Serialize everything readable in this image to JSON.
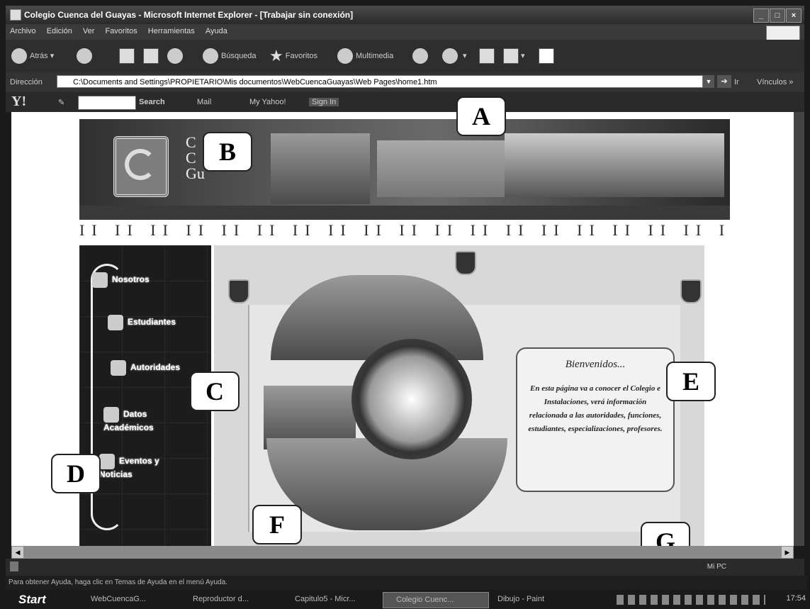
{
  "window": {
    "title": "Colegio Cuenca del Guayas - Microsoft Internet Explorer - [Trabajar sin conexión]",
    "controls": [
      "_",
      "□",
      "×"
    ]
  },
  "menu": [
    "Archivo",
    "Edición",
    "Ver",
    "Favoritos",
    "Herramientas",
    "Ayuda"
  ],
  "toolbar": {
    "back": "Atrás",
    "search": "Búsqueda",
    "favorites": "Favoritos",
    "multimedia": "Multimedia"
  },
  "address": {
    "label": "Dirección",
    "value": "C:\\Documents and Settings\\PROPIETARIO\\Mis documentos\\WebCuencaGuayas\\Web Pages\\home1.htm",
    "go": "Ir",
    "links": "Vínculos »"
  },
  "yahoo": {
    "logo": "Y!",
    "search": "Search",
    "mail": "Mail",
    "my_yahoo": "My Yahoo!",
    "sign_in": "Sign In"
  },
  "site": {
    "banner_text": [
      "C",
      "C",
      "Gu"
    ],
    "nav": [
      "Nosotros",
      "Estudiantes",
      "Autoridades",
      "Datos Académicos",
      "Eventos y Noticias"
    ],
    "welcome_title": "Bienvenidos...",
    "welcome_body": "En esta página va a conocer el Colegio e Instalaciones, verá información relacionada a las autoridades, funciones, estudiantes, especializaciones, profesores."
  },
  "callouts": [
    "A",
    "B",
    "C",
    "D",
    "E",
    "F",
    "G"
  ],
  "status": {
    "zone": "Mi PC",
    "help": "Para obtener Ayuda, haga clic en Temas de Ayuda en el menú Ayuda."
  },
  "taskbar": {
    "start": "Start",
    "tasks": [
      "WebCuencaG...",
      "Reproductor d...",
      "Capitulo5 - Micr...",
      "Colegio Cuenc...",
      "Dibujo - Paint"
    ],
    "clock": "17:54"
  }
}
